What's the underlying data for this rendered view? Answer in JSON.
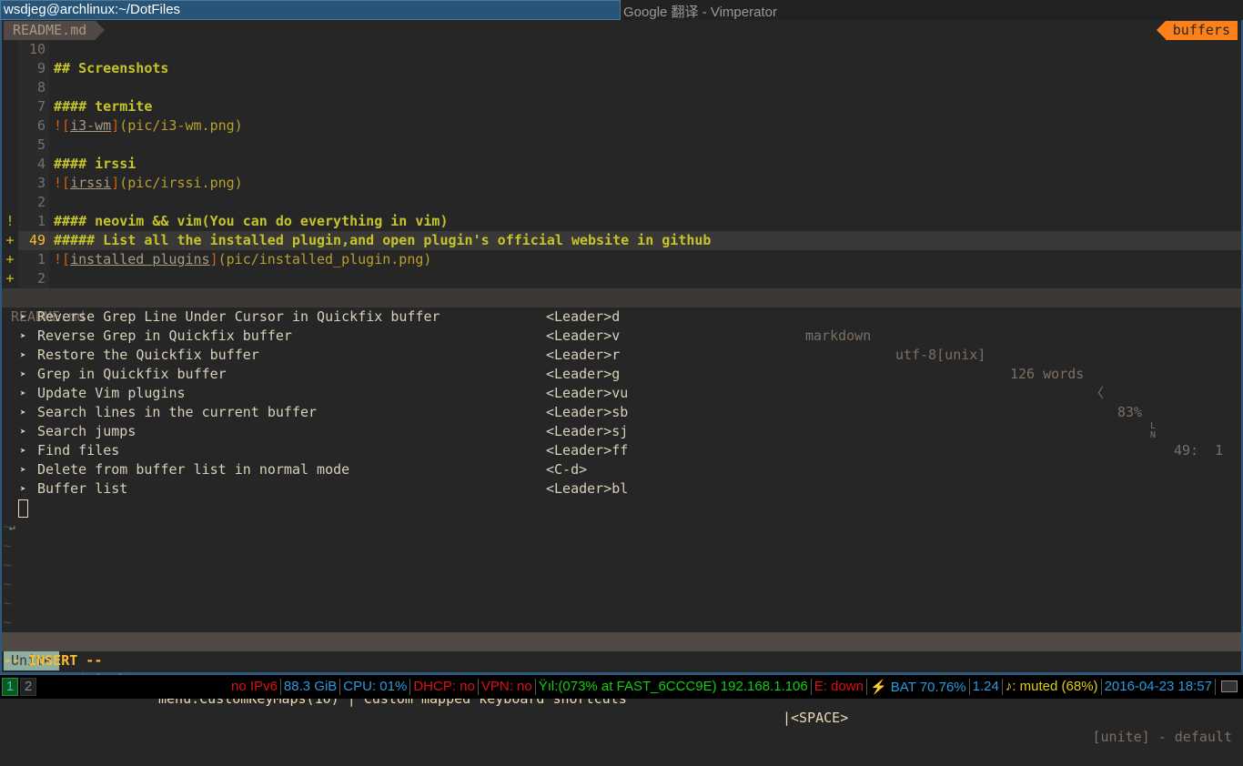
{
  "window": {
    "active_title": "wsdjeg@archlinux:~/DotFiles",
    "other_title": "Google 翻译 - Vimperator"
  },
  "tabline": {
    "buffer": "README.md",
    "right": "buffers"
  },
  "editor": {
    "lines": [
      {
        "sign": "",
        "num": "10",
        "parts": []
      },
      {
        "sign": "",
        "num": "9",
        "parts": [
          {
            "c": "hd",
            "t": "## Screenshots"
          }
        ]
      },
      {
        "sign": "",
        "num": "8",
        "parts": []
      },
      {
        "sign": "",
        "num": "7",
        "parts": [
          {
            "c": "hd",
            "t": "#### termite"
          }
        ]
      },
      {
        "sign": "",
        "num": "6",
        "parts": [
          {
            "c": "br",
            "t": "!["
          },
          {
            "c": "lk",
            "t": "i3-wm"
          },
          {
            "c": "br",
            "t": "]"
          },
          {
            "c": "ur",
            "t": "(pic/i3-wm.png)"
          }
        ]
      },
      {
        "sign": "",
        "num": "5",
        "parts": []
      },
      {
        "sign": "",
        "num": "4",
        "parts": [
          {
            "c": "hd",
            "t": "#### irssi"
          }
        ]
      },
      {
        "sign": "",
        "num": "3",
        "parts": [
          {
            "c": "br",
            "t": "!["
          },
          {
            "c": "lk",
            "t": "irssi"
          },
          {
            "c": "br",
            "t": "]"
          },
          {
            "c": "ur",
            "t": "(pic/irssi.png)"
          }
        ]
      },
      {
        "sign": "",
        "num": "2",
        "parts": []
      },
      {
        "sign": "!",
        "num": "1",
        "parts": [
          {
            "c": "hd",
            "t": "#### neovim && vim(You can do everything in vim)"
          }
        ]
      },
      {
        "sign": "+",
        "num": "49",
        "cursor": true,
        "parts": [
          {
            "c": "hd",
            "t": "##### List all the installed plugin,and open plugin's official website in github"
          }
        ]
      },
      {
        "sign": "+",
        "num": "1",
        "parts": [
          {
            "c": "br",
            "t": "!["
          },
          {
            "c": "lk",
            "t": "installed plugins"
          },
          {
            "c": "br",
            "t": "]"
          },
          {
            "c": "ur",
            "t": "(pic/installed_plugin.png)"
          }
        ]
      },
      {
        "sign": "+",
        "num": "2",
        "parts": []
      }
    ]
  },
  "statusline": {
    "file": "README.md",
    "filetype": "markdown",
    "encoding": "utf-8[unix]",
    "words": "126 words",
    "percent": "83%",
    "position": "49:  1"
  },
  "menu": {
    "items": [
      {
        "label": "Reverse Grep Line Under Cursor in Quickfix buffer",
        "key": "<Leader>d"
      },
      {
        "label": "Reverse Grep in Quickfix buffer",
        "key": "<Leader>v"
      },
      {
        "label": "Restore the Quickfix buffer",
        "key": "<Leader>r"
      },
      {
        "label": "Grep in Quickfix buffer",
        "key": "<Leader>g"
      },
      {
        "label": "Update Vim plugins",
        "key": "<Leader>vu"
      },
      {
        "label": "Search lines in the current buffer",
        "key": "<Leader>sb"
      },
      {
        "label": "Search jumps",
        "key": "<Leader>sj"
      },
      {
        "label": "Find files",
        "key": "<Leader>ff"
      },
      {
        "label": "Delete from buffer list in normal mode",
        "key": "<C-d>"
      },
      {
        "label": "Buffer list",
        "key": "<Leader>bl"
      }
    ]
  },
  "unite": {
    "mode": "Unite",
    "profile": "default",
    "source": "menu:CustomKeyMaps(10) | Custom mapped keyboard shortcuts",
    "key": "|<SPACE>",
    "right": "[unite] - default"
  },
  "mode": "-- INSERT --",
  "bar": {
    "workspaces": [
      "1",
      "2"
    ],
    "status": [
      {
        "t": "no IPv6",
        "color": "#e01010"
      },
      {
        "t": "88.3 GiB",
        "color": "#2a9ae0"
      },
      {
        "t": "CPU: 01%",
        "color": "#2a9ae0"
      },
      {
        "t": "DHCP: no",
        "color": "#e01010"
      },
      {
        "t": "VPN: no",
        "color": "#e01010"
      },
      {
        "t": "Ÿıl:(073% at FAST_6CCC9E) 192.168.1.106",
        "color": "#10d010"
      },
      {
        "t": "E: down",
        "color": "#e01010"
      },
      {
        "t": "⚡ BAT 70.76%",
        "color": "#2a9ae0"
      },
      {
        "t": "1.24",
        "color": "#2a9ae0"
      },
      {
        "t": "♪: muted (68%)",
        "color": "#e0d010"
      },
      {
        "t": "2016-04-23 18:57",
        "color": "#2a9ae0"
      }
    ]
  }
}
